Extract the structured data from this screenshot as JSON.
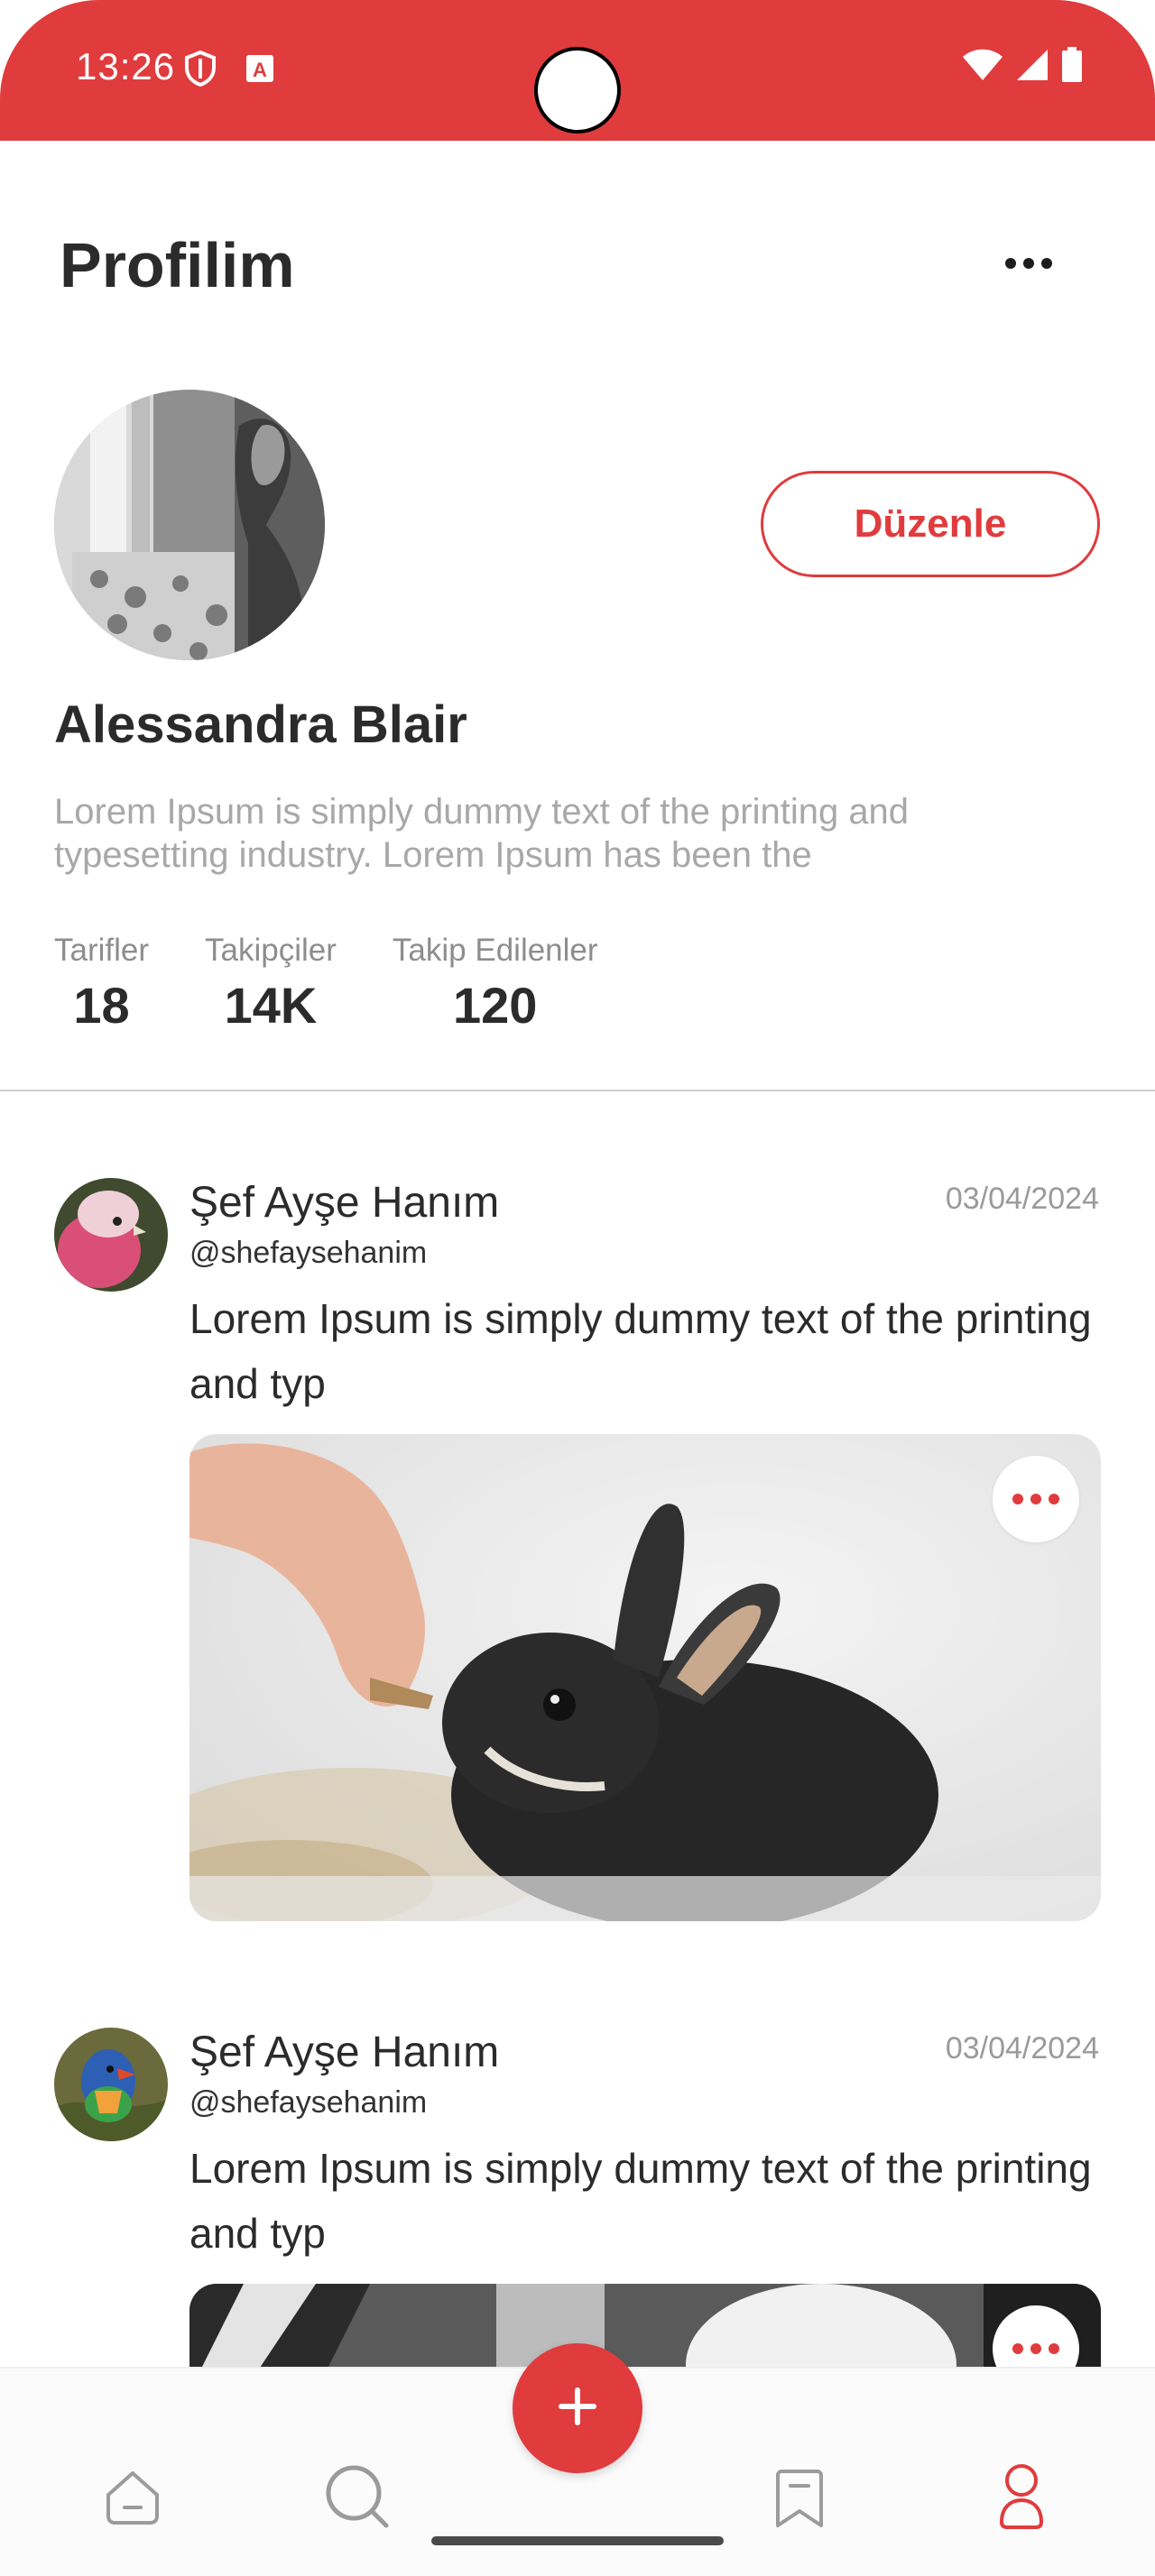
{
  "status_bar": {
    "time": "13:26",
    "icons": [
      "shield-icon",
      "a-badge-icon",
      "wifi-icon",
      "signal-icon",
      "battery-icon"
    ],
    "color": "#e03b3d"
  },
  "header": {
    "title": "Profilim",
    "menu_icon": "more-horizontal-icon"
  },
  "profile": {
    "name": "Alessandra Blair",
    "bio": "Lorem Ipsum is simply dummy text of the printing and typesetting industry. Lorem Ipsum has been the",
    "edit_label": "Düzenle",
    "stats": [
      {
        "label": "Tarifler",
        "value": "18"
      },
      {
        "label": "Takipçiler",
        "value": "14K"
      },
      {
        "label": "Takip Edilenler",
        "value": "120"
      }
    ]
  },
  "posts": [
    {
      "author": "Şef Ayşe Hanım",
      "handle": "@shefaysehanim",
      "date": "03/04/2024",
      "text": "Lorem Ipsum is simply dummy text of the printing and typ"
    },
    {
      "author": "Şef Ayşe Hanım",
      "handle": "@shefaysehanim",
      "date": "03/04/2024",
      "text": "Lorem Ipsum is simply dummy text of the printing and typ"
    }
  ],
  "bottom_nav": {
    "items": [
      {
        "icon": "home-icon",
        "active": false
      },
      {
        "icon": "search-icon",
        "active": false
      },
      {
        "icon": "add-icon",
        "active": false
      },
      {
        "icon": "bookmark-icon",
        "active": false
      },
      {
        "icon": "profile-icon",
        "active": true
      }
    ],
    "accent": "#e03b3d"
  }
}
